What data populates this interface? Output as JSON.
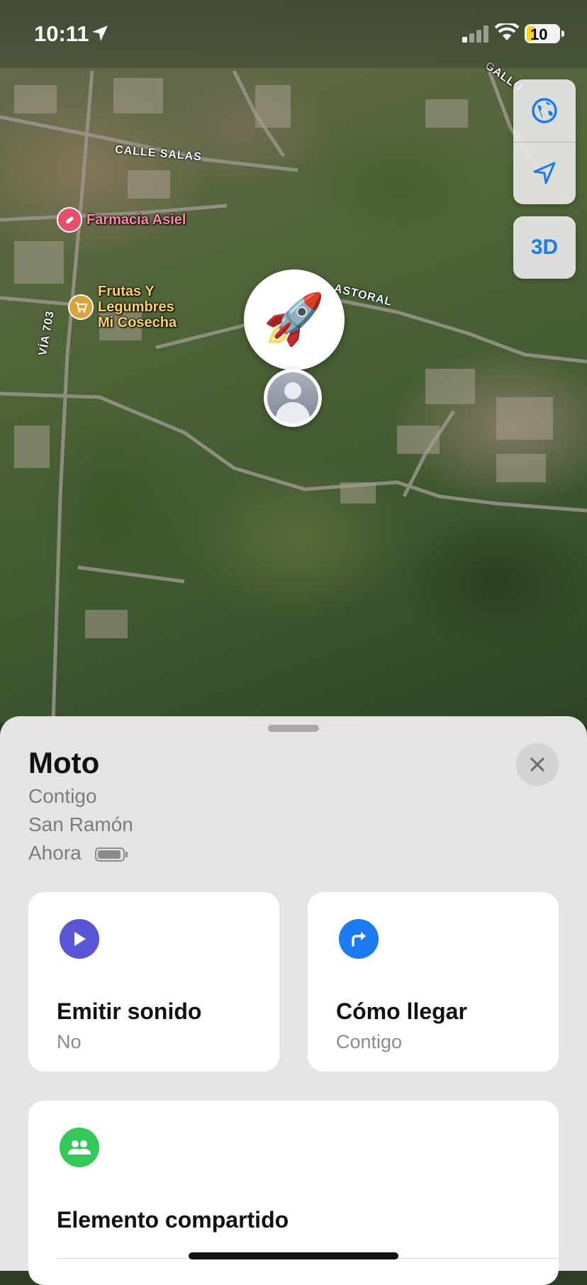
{
  "status_bar": {
    "time": "10:11",
    "battery_level": "10"
  },
  "map": {
    "roads": [
      "CALLE SALAS",
      "VÍA 703",
      "ASTORAL",
      "GALLO"
    ],
    "pois": [
      {
        "name": "Farmacia Asiel",
        "icon": "pharmacy-icon",
        "color": "#e6506e"
      },
      {
        "name": "Frutas Y\nLegumbres\nMi Cosecha",
        "icon": "shopping-cart-icon",
        "color": "#d9a23a"
      }
    ],
    "controls": {
      "map_mode_icon": "globe-icon",
      "location_icon": "location-arrow-icon",
      "three_d_label": "3D"
    },
    "item_emoji": "🚀"
  },
  "sheet": {
    "item_name": "Moto",
    "details": [
      "Contigo",
      "San Ramón",
      "Ahora"
    ],
    "cards": {
      "sound": {
        "title": "Emitir sonido",
        "subtitle": "No",
        "icon_color": "#5856d6"
      },
      "directions": {
        "title": "Cómo llegar",
        "subtitle": "Contigo",
        "icon_color": "#1a7cf0"
      },
      "shared": {
        "title": "Elemento compartido",
        "icon_color": "#34c759"
      }
    }
  }
}
